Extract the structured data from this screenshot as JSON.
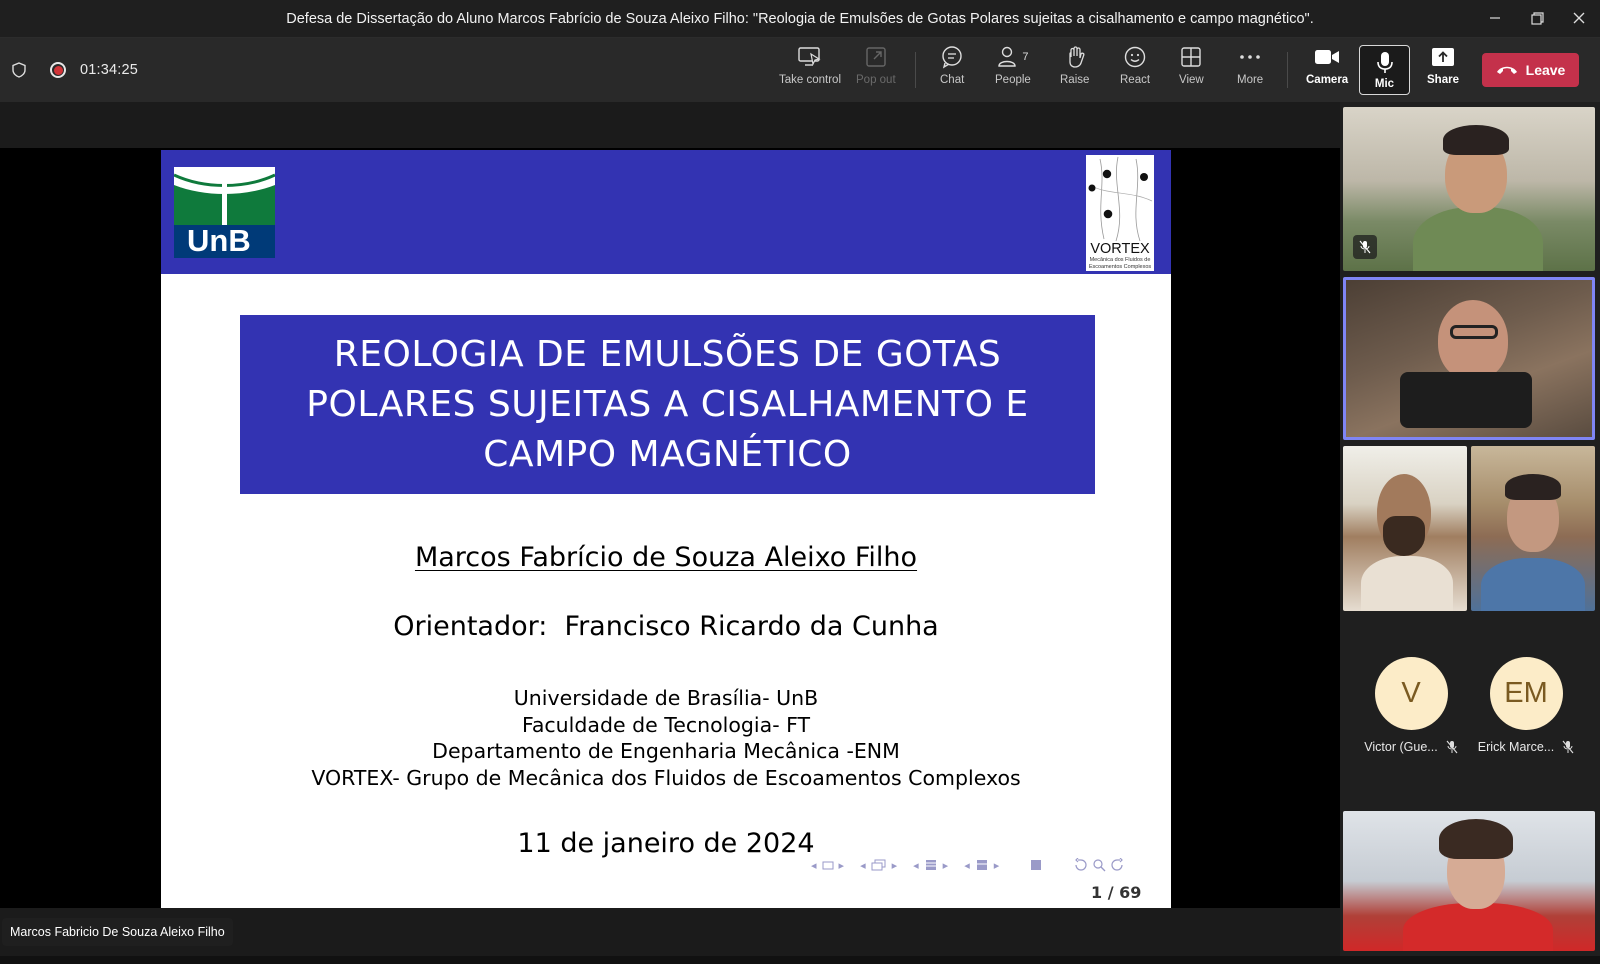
{
  "window": {
    "title": "Defesa de Dissertação do Aluno Marcos Fabrício de Souza Aleixo Filho: \"Reologia de Emulsões de Gotas Polares sujeitas a cisalhamento e campo magnético\"."
  },
  "toolbar": {
    "timer": "01:34:25",
    "take_control": "Take control",
    "pop_out": "Pop out",
    "chat": "Chat",
    "people": "People",
    "people_count": "7",
    "raise": "Raise",
    "react": "React",
    "view": "View",
    "more": "More",
    "camera": "Camera",
    "mic": "Mic",
    "share": "Share",
    "leave": "Leave",
    "colors": {
      "leave": "#c4314b",
      "recording": "#d13438"
    }
  },
  "slide": {
    "unb_logo": "UnB",
    "vortex_logo": "VORTEX",
    "vortex_sub": "Mecânica dos Fluidos de Escoamentos Complexos",
    "title": "REOLOGIA DE EMULSÕES DE GOTAS POLARES SUJEITAS A CISALHAMENTO E CAMPO MAGNÉTICO",
    "author": "Marcos Fabrício de Souza Aleixo Filho",
    "advisor": "Orientador:  Francisco Ricardo da Cunha",
    "institution": [
      "Universidade de Brasília- UnB",
      "Faculdade de Tecnologia- FT",
      "Departamento de Engenharia Mecânica -ENM",
      "VORTEX- Grupo de Mecânica dos Fluidos de Escoamentos Complexos"
    ],
    "date": "11 de janeiro de 2024",
    "page": "1 / 69",
    "colors": {
      "header": "#3333b2"
    }
  },
  "speaker_label": "Marcos Fabricio De Souza Aleixo Filho",
  "participants": [
    {
      "initials": "V",
      "name": "Victor (Gue..."
    },
    {
      "initials": "EM",
      "name": "Erick Marce..."
    }
  ]
}
